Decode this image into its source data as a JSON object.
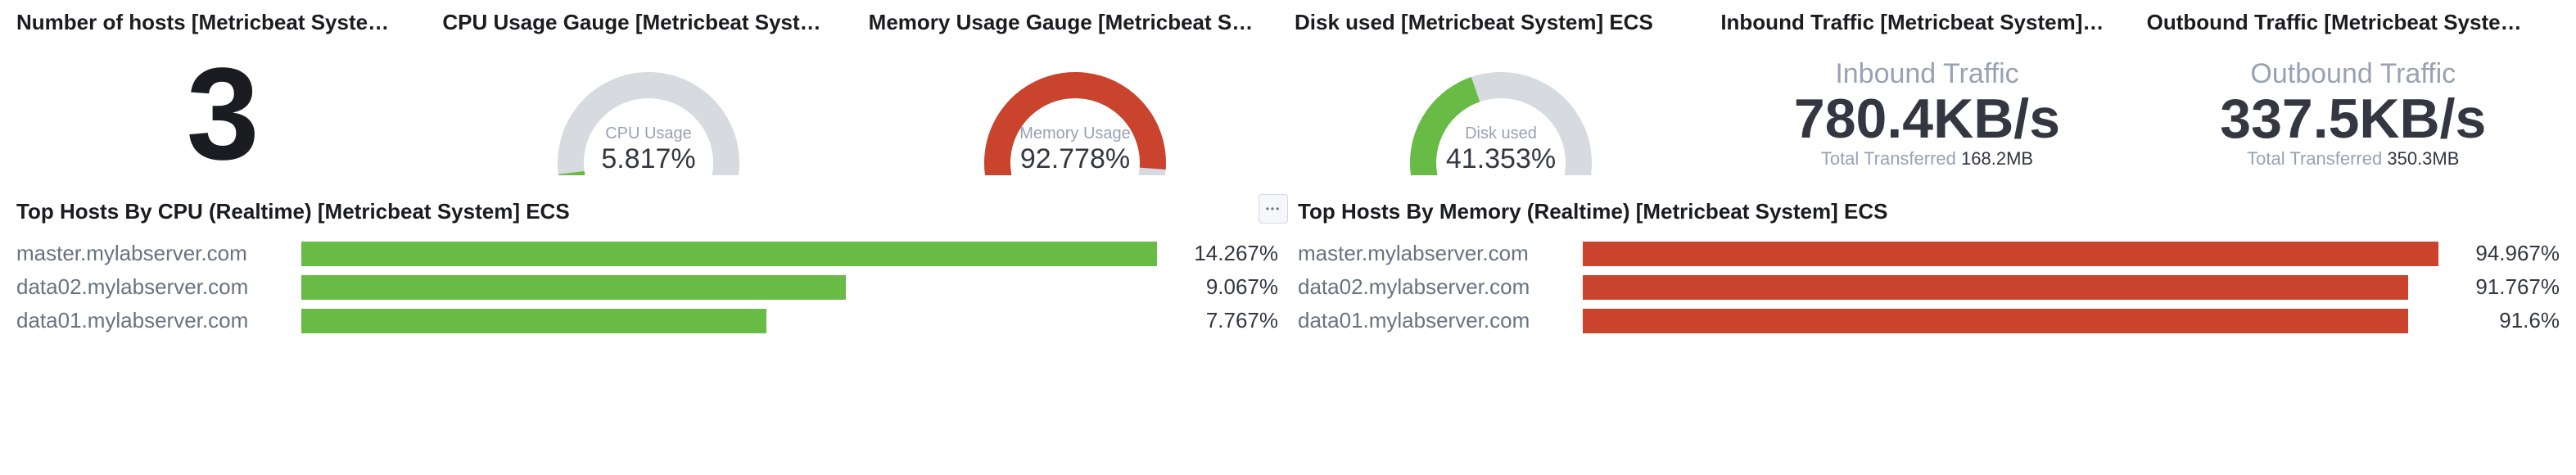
{
  "panels": {
    "hosts": {
      "title": "Number of hosts [Metricbeat Syste…",
      "value": "3"
    },
    "cpu": {
      "title": "CPU Usage Gauge [Metricbeat Syst…",
      "label": "CPU Usage",
      "value": "5.817%",
      "pct": 5.817,
      "color": "#68bc45"
    },
    "memory": {
      "title": "Memory Usage Gauge [Metricbeat S…",
      "label": "Memory Usage",
      "value": "92.778%",
      "pct": 92.778,
      "color": "#c9432d"
    },
    "disk": {
      "title": "Disk used [Metricbeat System] ECS",
      "label": "Disk used",
      "value": "41.353%",
      "pct": 41.353,
      "color": "#68bc45"
    },
    "inbound": {
      "title": "Inbound Traffic [Metricbeat System]…",
      "label": "Inbound Traffic",
      "value": "780.4KB/s",
      "sub_label": "Total Transferred",
      "sub_value": "168.2MB"
    },
    "outbound": {
      "title": "Outbound Traffic [Metricbeat Syste…",
      "label": "Outbound Traffic",
      "value": "337.5KB/s",
      "sub_label": "Total Transferred",
      "sub_value": "350.3MB"
    }
  },
  "top_cpu": {
    "title": "Top Hosts By CPU (Realtime) [Metricbeat System] ECS",
    "color": "#68bc45",
    "rows": [
      {
        "host": "master.mylabserver.com",
        "value": "14.267%",
        "bar": 100.0
      },
      {
        "host": "data02.mylabserver.com",
        "value": "9.067%",
        "bar": 63.6
      },
      {
        "host": "data01.mylabserver.com",
        "value": "7.767%",
        "bar": 54.4
      }
    ]
  },
  "top_mem": {
    "title": "Top Hosts By Memory (Realtime) [Metricbeat System] ECS",
    "color": "#c9432d",
    "rows": [
      {
        "host": "master.mylabserver.com",
        "value": "94.967%",
        "bar": 100.0
      },
      {
        "host": "data02.mylabserver.com",
        "value": "91.767%",
        "bar": 96.5
      },
      {
        "host": "data01.mylabserver.com",
        "value": "91.6%",
        "bar": 96.5
      }
    ]
  },
  "chart_data": [
    {
      "type": "gauge",
      "title": "CPU Usage Gauge",
      "label": "CPU Usage",
      "value": 5.817,
      "max": 100,
      "unit": "%"
    },
    {
      "type": "gauge",
      "title": "Memory Usage Gauge",
      "label": "Memory Usage",
      "value": 92.778,
      "max": 100,
      "unit": "%"
    },
    {
      "type": "gauge",
      "title": "Disk used",
      "label": "Disk used",
      "value": 41.353,
      "max": 100,
      "unit": "%"
    },
    {
      "type": "bar",
      "title": "Top Hosts By CPU (Realtime)",
      "unit": "%",
      "categories": [
        "master.mylabserver.com",
        "data02.mylabserver.com",
        "data01.mylabserver.com"
      ],
      "values": [
        14.267,
        9.067,
        7.767
      ]
    },
    {
      "type": "bar",
      "title": "Top Hosts By Memory (Realtime)",
      "unit": "%",
      "categories": [
        "master.mylabserver.com",
        "data02.mylabserver.com",
        "data01.mylabserver.com"
      ],
      "values": [
        94.967,
        91.767,
        91.6
      ]
    }
  ]
}
